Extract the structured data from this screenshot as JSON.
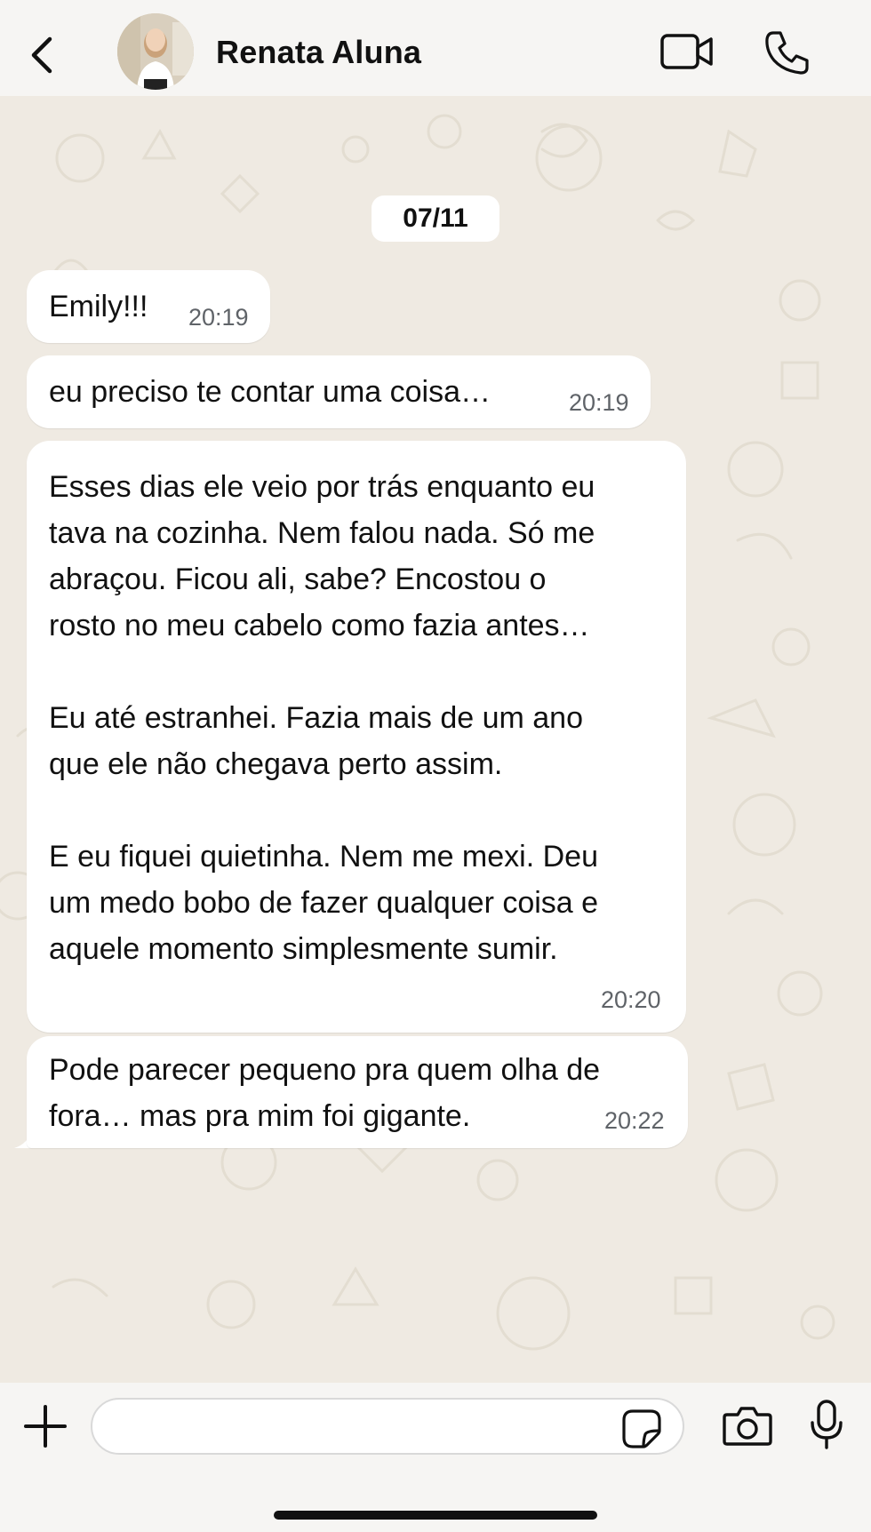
{
  "header": {
    "contact_name": "Renata Aluna",
    "back_icon": "chevron-left-icon",
    "video_icon": "video-camera-icon",
    "call_icon": "phone-icon"
  },
  "chat": {
    "date_label": "07/11",
    "messages": [
      {
        "text": "Emily!!!",
        "time": "20:19"
      },
      {
        "text": "eu preciso te contar uma coisa…",
        "time": "20:19"
      },
      {
        "text": "Esses dias ele veio por trás enquanto eu\ntava na cozinha. Nem falou nada. Só me\nabraçou. Ficou ali, sabe? Encostou o\nrosto no meu cabelo como fazia antes…\n\nEu até estranhei. Fazia mais de um ano\nque ele não chegava perto assim.\n\nE eu fiquei quietinha. Nem me mexi. Deu\num medo bobo de fazer qualquer coisa e\naquele momento simplesmente sumir.",
        "time": "20:20"
      },
      {
        "text": "Pode parecer pequeno pra quem olha de\nfora… mas pra mim foi gigante.",
        "time": "20:22"
      }
    ]
  },
  "composer": {
    "input_value": "",
    "input_placeholder": "",
    "plus_icon": "plus-icon",
    "sticker_icon": "sticker-icon",
    "camera_icon": "camera-icon",
    "mic_icon": "microphone-icon"
  },
  "colors": {
    "chat_background": "#efeae2",
    "bar_background": "#f6f5f3",
    "bubble_incoming": "#ffffff",
    "timestamp": "#5f6368"
  }
}
